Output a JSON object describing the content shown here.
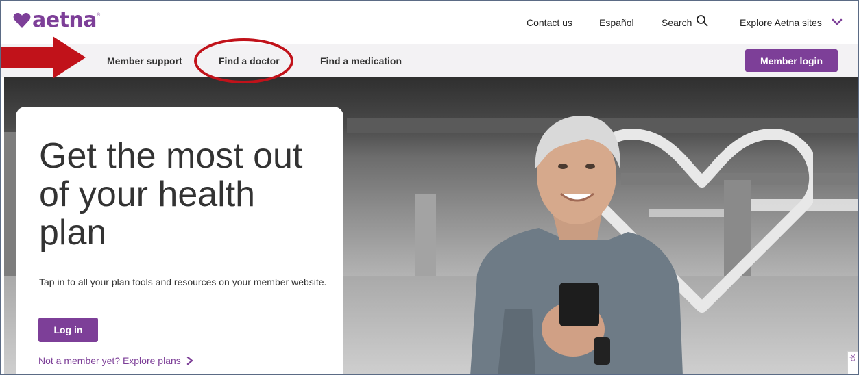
{
  "brand": {
    "name": "aetna",
    "registered_mark": "®",
    "color": "#7d3f98"
  },
  "utility_nav": {
    "contact_label": "Contact us",
    "espanol_label": "Español",
    "search_label": "Search",
    "search_icon": "search-icon",
    "explore_label": "Explore Aetna sites",
    "explore_icon": "chevron-down-icon"
  },
  "main_nav": {
    "items": [
      {
        "label": "Member support"
      },
      {
        "label": "Find a doctor",
        "highlighted": true
      },
      {
        "label": "Find a medication"
      }
    ],
    "login_label": "Member login"
  },
  "annotations": {
    "arrow_color": "#c1121a",
    "circle_color": "#c1121a",
    "circled_item": "Find a doctor"
  },
  "hero": {
    "title": "Get the most out of your health plan",
    "description": "Tap in to all your plan tools and resources on your member website.",
    "login_label": "Log in",
    "explore_link": "Not a member yet? Explore plans",
    "feedback_label": "ck"
  }
}
